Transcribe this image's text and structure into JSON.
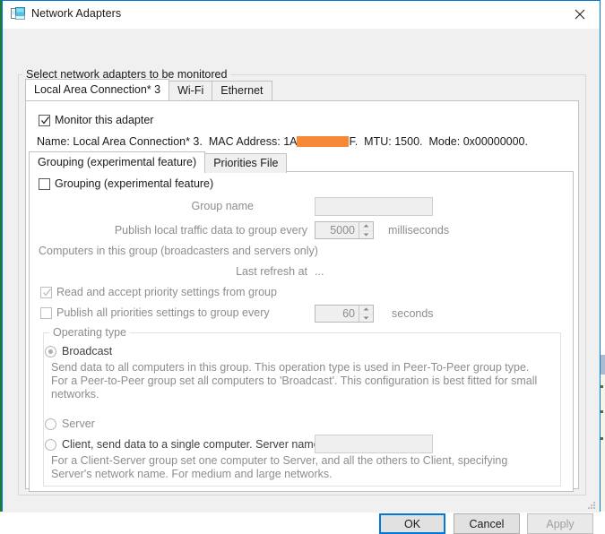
{
  "window": {
    "title": "Network Adapters",
    "app_icon": "network-adapter-icon",
    "close_icon": "close-icon",
    "accent_color": "#0078d7"
  },
  "group": {
    "legend": "Select network adapters to be monitored"
  },
  "adapter_tabs": [
    {
      "label": "Local Area Connection* 3",
      "selected": true
    },
    {
      "label": "Wi-Fi",
      "selected": false
    },
    {
      "label": "Ethernet",
      "selected": false
    }
  ],
  "monitor": {
    "label": "Monitor this adapter",
    "checked": true
  },
  "info": {
    "name_label": "Name:",
    "name_value": "Local Area Connection* 3.",
    "mac_label": "MAC Address:",
    "mac_prefix": "1A",
    "mac_redacted": true,
    "mac_suffix": "F.",
    "mtu_label": "MTU:",
    "mtu_value": "1500.",
    "mode_label": "Mode:",
    "mode_value": "0x00000000.",
    "redaction_color": "#f78838"
  },
  "inner_tabs": [
    {
      "label": "Grouping (experimental feature)",
      "selected": true
    },
    {
      "label": "Priorities File",
      "selected": false
    }
  ],
  "grouping": {
    "enable_label": "Grouping (experimental feature)",
    "enable_checked": false,
    "group_name_label": "Group name",
    "group_name_value": "",
    "group_name_placeholder": "",
    "publish_traffic_label": "Publish local traffic data to group every",
    "publish_traffic_value": "5000",
    "publish_traffic_units": "milliseconds",
    "computers_label": "Computers in this group (broadcasters and servers only)",
    "last_refresh_label": "Last refresh at",
    "last_refresh_value": "...",
    "read_priority_label": "Read and accept priority settings from group",
    "read_priority_checked": true,
    "publish_priority_label": "Publish all priorities settings to group every",
    "publish_priority_checked": false,
    "publish_priority_value": "60",
    "publish_priority_units": "seconds"
  },
  "operating_type": {
    "legend": "Operating type",
    "options": [
      {
        "label": "Broadcast",
        "selected": true,
        "description": "Send data to all computers in this group. This operation type is used in Peer-To-Peer group type. For a Peer-to-Peer group set all computers to 'Broadcast'. This configuration is best fitted for small networks."
      },
      {
        "label": "Server",
        "selected": false,
        "description": ""
      },
      {
        "label": "Client, send data to a single computer. Server name:",
        "selected": false,
        "description": "For a Client-Server group set one computer to Server, and all the others to Client, specifying Server's network name. For medium and large networks."
      }
    ],
    "server_name_value": ""
  },
  "buttons": {
    "ok": "OK",
    "cancel": "Cancel",
    "apply": "Apply"
  }
}
